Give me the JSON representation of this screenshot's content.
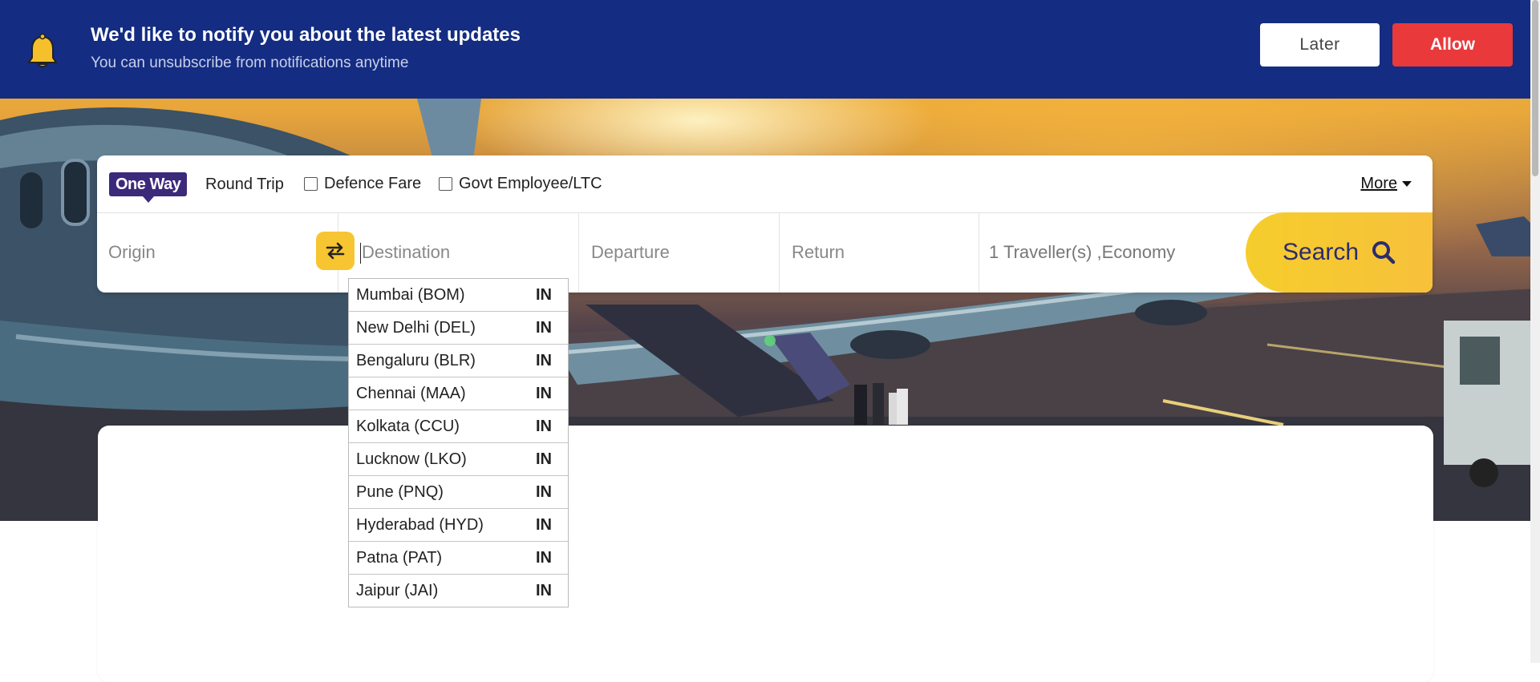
{
  "notification": {
    "title": "We'd like to notify you about the latest updates",
    "subtitle": "You can unsubscribe from notifications anytime",
    "later_label": "Later",
    "allow_label": "Allow",
    "icon": "bell-icon"
  },
  "trip_types": {
    "one_way": "One Way",
    "round_trip": "Round Trip",
    "defence_fare": "Defence Fare",
    "govt_employee": "Govt Employee/LTC",
    "more": "More"
  },
  "fields": {
    "origin_placeholder": "Origin",
    "destination_placeholder": "Destination",
    "departure_placeholder": "Departure",
    "return_placeholder": "Return",
    "traveller": "1 Traveller(s) ,Economy",
    "search_label": "Search"
  },
  "destination_suggestions": [
    {
      "city": "Mumbai (BOM)",
      "country": "IN"
    },
    {
      "city": "New Delhi (DEL)",
      "country": "IN"
    },
    {
      "city": "Bengaluru (BLR)",
      "country": "IN"
    },
    {
      "city": "Chennai (MAA)",
      "country": "IN"
    },
    {
      "city": "Kolkata (CCU)",
      "country": "IN"
    },
    {
      "city": "Lucknow (LKO)",
      "country": "IN"
    },
    {
      "city": "Pune (PNQ)",
      "country": "IN"
    },
    {
      "city": "Hyderabad (HYD)",
      "country": "IN"
    },
    {
      "city": "Patna (PAT)",
      "country": "IN"
    },
    {
      "city": "Jaipur (JAI)",
      "country": "IN"
    }
  ],
  "colors": {
    "notification_bg": "#142c82",
    "allow_bg": "#e9393a",
    "accent_yellow": "#f7c531",
    "one_way_bg": "#3b2a7a",
    "search_text": "#2c2c6e"
  }
}
